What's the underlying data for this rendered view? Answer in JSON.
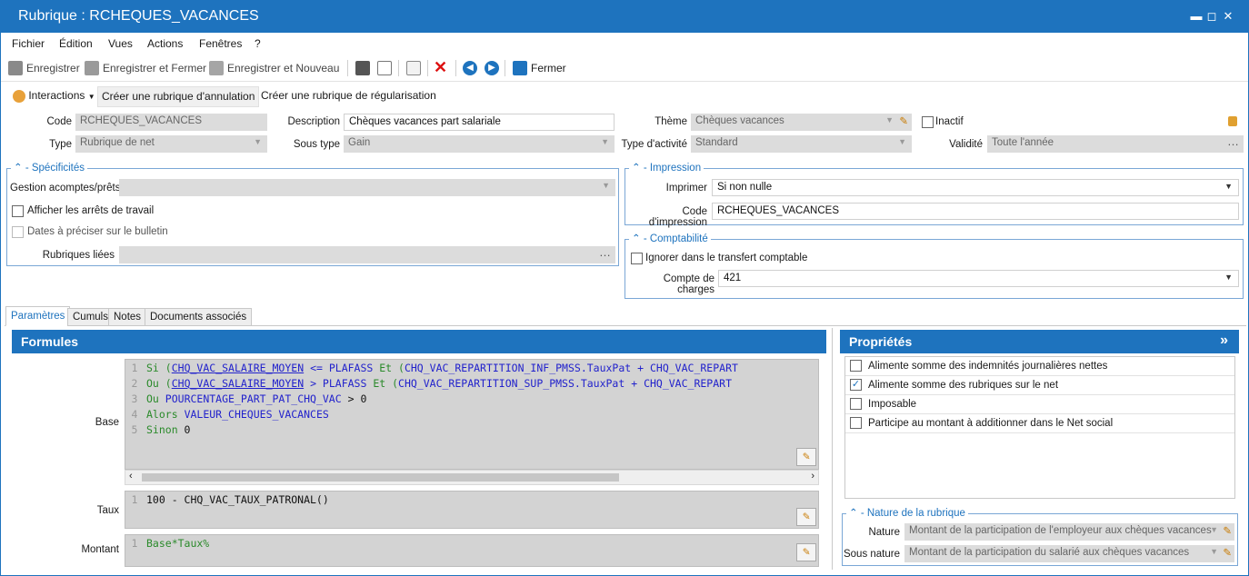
{
  "window": {
    "title": "Rubrique : RCHEQUES_VACANCES",
    "minimize": "▬",
    "maximize": "◻",
    "close": "✕"
  },
  "menu": [
    "Fichier",
    "Édition",
    "Vues",
    "Actions",
    "Fenêtres",
    "?"
  ],
  "toolbar": {
    "save": "Enregistrer",
    "save_close": "Enregistrer et Fermer",
    "save_new": "Enregistrer et Nouveau",
    "close": "Fermer"
  },
  "actions": {
    "interactions": "Interactions",
    "create_cancel": "Créer une rubrique d'annulation",
    "create_regul": "Créer une rubrique de régularisation"
  },
  "header": {
    "code_label": "Code",
    "code_value": "RCHEQUES_VACANCES",
    "type_label": "Type",
    "type_value": "Rubrique de net",
    "description_label": "Description",
    "description_value": "Chèques vacances part salariale",
    "soustype_label": "Sous type",
    "soustype_value": "Gain",
    "theme_label": "Thème",
    "theme_value": "Chèques vacances",
    "activite_label": "Type d'activité",
    "activite_value": "Standard",
    "inactif_label": "Inactif",
    "validite_label": "Validité",
    "validite_value": "Toute l'année"
  },
  "specificites": {
    "title": "Spécificités",
    "acomptes_label": "Gestion acomptes/prêts",
    "acomptes_value": "",
    "arrets_label": "Afficher les arrêts de travail",
    "dates_label": "Dates à préciser sur le bulletin",
    "liees_label": "Rubriques liées"
  },
  "impression": {
    "title": "Impression",
    "imprimer_label": "Imprimer",
    "imprimer_value": "Si non nulle",
    "code_label": "Code d'impression",
    "code_value": "RCHEQUES_VACANCES"
  },
  "comptabilite": {
    "title": "Comptabilité",
    "ignorer_label": "Ignorer dans le transfert comptable",
    "compte_label": "Compte de charges",
    "compte_value": "421"
  },
  "tabs": [
    "Paramètres",
    "Cumuls",
    "Notes",
    "Documents associés"
  ],
  "formules": {
    "title": "Formules",
    "base_label": "Base",
    "taux_label": "Taux",
    "montant_label": "Montant",
    "base_lines": [
      [
        "1",
        "Si",
        "(",
        "CHQ_VAC_SALAIRE_MOYEN",
        " <= ",
        "PLAFASS",
        " Et ",
        "(",
        "CHQ_VAC_REPARTITION_INF_PMSS.TauxPat",
        " + ",
        "CHQ_VAC_REPART"
      ],
      [
        "2",
        "Ou",
        "(",
        "CHQ_VAC_SALAIRE_MOYEN",
        " > ",
        "PLAFASS",
        " Et ",
        "(",
        "CHQ_VAC_REPARTITION_SUP_PMSS.TauxPat",
        " + ",
        "CHQ_VAC_REPART"
      ]
    ],
    "base_line3": {
      "n": "3",
      "kw": "Ou",
      "id": "POURCENTAGE_PART_PAT_CHQ_VAC",
      "rest": " > 0"
    },
    "base_line4": {
      "n": "4",
      "kw": "Alors",
      "id": "VALEUR_CHEQUES_VACANCES"
    },
    "base_line5": {
      "n": "5",
      "kw": "Sinon",
      "rest": " 0"
    },
    "taux_line": {
      "n": "1",
      "text": "100 - CHQ_VAC_TAUX_PATRONAL()"
    },
    "montant_line": {
      "n": "1",
      "text": "Base*Taux%"
    }
  },
  "proprietes": {
    "title": "Propriétés",
    "expand": "»",
    "items": [
      {
        "label": "Alimente somme des indemnités journalières nettes",
        "checked": ""
      },
      {
        "label": "Alimente somme des rubriques sur le net",
        "checked": "✓"
      },
      {
        "label": "Imposable",
        "checked": ""
      },
      {
        "label": "Participe au montant à additionner dans le Net social",
        "checked": ""
      }
    ]
  },
  "nature": {
    "title": "Nature de la rubrique",
    "nature_label": "Nature",
    "nature_value": "Montant de la participation de l'employeur aux chèques vacances",
    "sousnature_label": "Sous nature",
    "sousnature_value": "Montant de la participation du salarié aux chèques vacances"
  }
}
